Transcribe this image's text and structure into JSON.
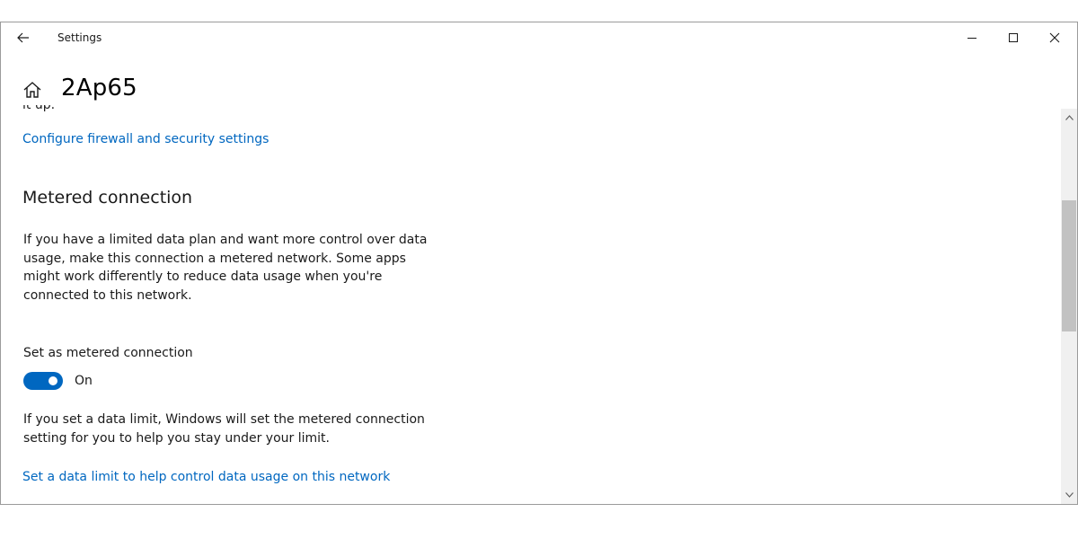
{
  "window": {
    "title": "Settings"
  },
  "page": {
    "title": "2Ap65",
    "cut_text": "it up."
  },
  "firewall": {
    "link_label": "Configure firewall and security settings"
  },
  "metered": {
    "heading": "Metered connection",
    "description": "If you have a limited data plan and want more control over data usage, make this connection a metered network. Some apps might work differently to reduce data usage when you're connected to this network.",
    "toggle_label": "Set as metered connection",
    "toggle_state": "On",
    "toggle_on": true,
    "limit_note": "If you set a data limit, Windows will set the metered connection setting for you to help you stay under your limit.",
    "data_limit_link": "Set a data limit to help control data usage on this network"
  },
  "icons": {
    "back": "back-arrow-icon",
    "home": "home-icon",
    "minimize": "minimize-icon",
    "maximize": "maximize-icon",
    "close": "close-icon",
    "scroll_up": "chevron-up-icon",
    "scroll_down": "chevron-down-icon"
  },
  "colors": {
    "accent": "#0067c0",
    "text": "#1a1a1a",
    "scrollbar_track": "#f0f0f0",
    "scrollbar_thumb": "#c2c2c2"
  }
}
